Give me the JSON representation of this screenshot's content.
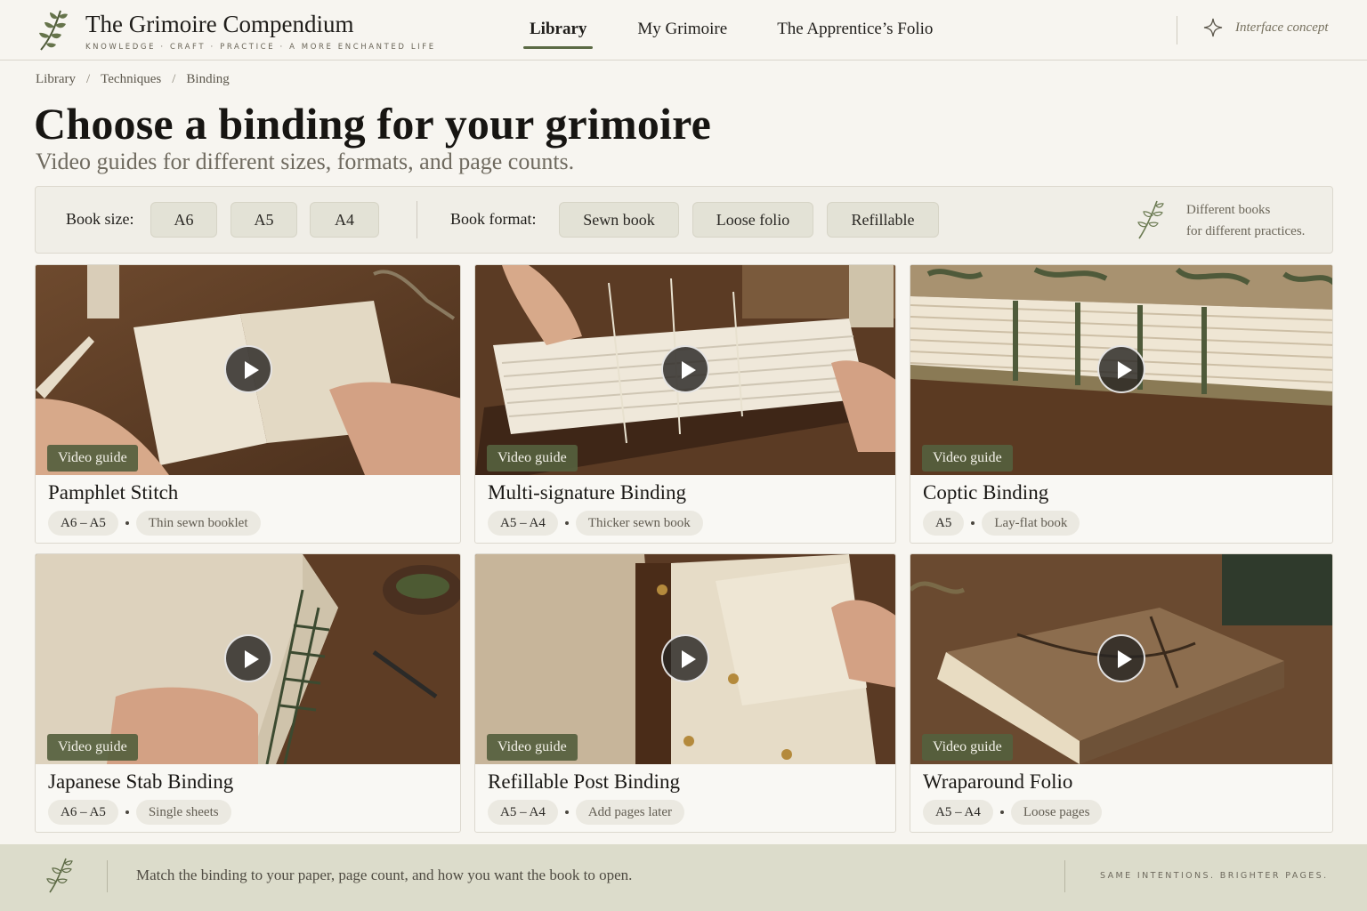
{
  "brand": {
    "title": "The Grimoire Compendium",
    "tagline": "KNOWLEDGE · CRAFT · PRACTICE · A MORE ENCHANTED LIFE",
    "icon": "sprig-icon"
  },
  "nav": {
    "items": [
      {
        "label": "Library",
        "active": true
      },
      {
        "label": "My Grimoire",
        "active": false
      },
      {
        "label": "The Apprentice’s Folio",
        "active": false
      }
    ]
  },
  "concept": {
    "label": "Interface concept",
    "icon": "sparkle-icon"
  },
  "breadcrumb": [
    "Library",
    "Techniques",
    "Binding"
  ],
  "breadcrumb_separator": "/",
  "page": {
    "title": "Choose a binding for your grimoire",
    "subtitle": "Video guides for different sizes, formats, and page counts."
  },
  "filters": {
    "size_label": "Book size:",
    "sizes": [
      "A6",
      "A5",
      "A4"
    ],
    "format_label": "Book format:",
    "formats": [
      "Sewn book",
      "Loose folio",
      "Refillable"
    ],
    "note_line1": "Different books",
    "note_line2": "for different practices."
  },
  "cards": [
    {
      "badge": "Video guide",
      "title": "Pamphlet Stitch",
      "size": "A6 – A5",
      "desc": "Thin sewn booklet"
    },
    {
      "badge": "Video guide",
      "title": "Multi-signature Binding",
      "size": "A5 – A4",
      "desc": "Thicker sewn book"
    },
    {
      "badge": "Video guide",
      "title": "Coptic Binding",
      "size": "A5",
      "desc": "Lay-flat book"
    },
    {
      "badge": "Video guide",
      "title": "Japanese Stab Binding",
      "size": "A6 – A5",
      "desc": "Single sheets"
    },
    {
      "badge": "Video guide",
      "title": "Refillable Post Binding",
      "size": "A5 – A4",
      "desc": "Add pages later"
    },
    {
      "badge": "Video guide",
      "title": "Wraparound Folio",
      "size": "A5 – A4",
      "desc": "Loose pages"
    }
  ],
  "footer": {
    "text": "Match the binding to your paper, page count, and how you want the book to open.",
    "motto": "SAME INTENTIONS. BRIGHTER PAGES."
  },
  "colors": {
    "accent": "#5b6a44",
    "background": "#f7f5f0",
    "badge": "#55603e",
    "footer": "#dcdccb"
  }
}
